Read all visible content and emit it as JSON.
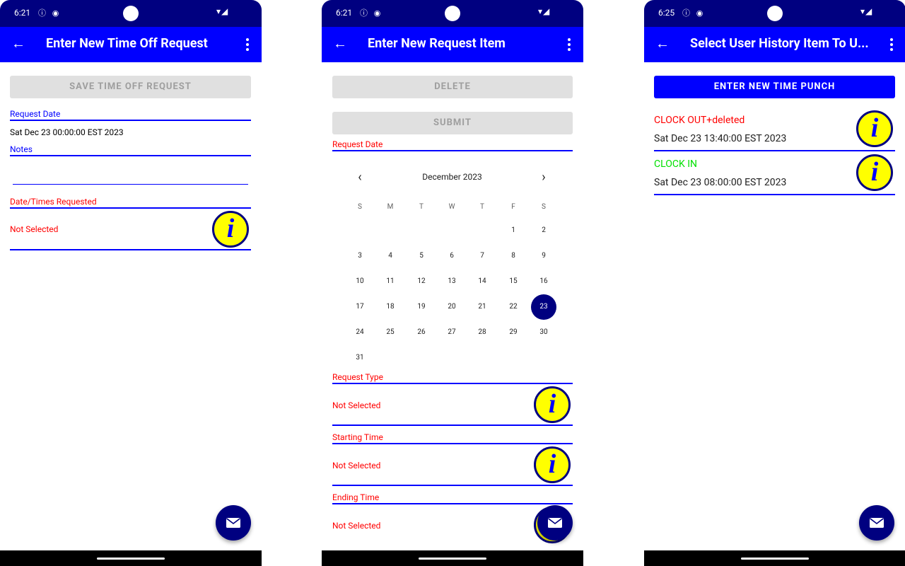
{
  "status_bars": [
    {
      "time": "6:21",
      "left_icons": "ⓘ ◉",
      "right_icons": "▾◢"
    },
    {
      "time": "6:21",
      "left_icons": "ⓘ ◉",
      "right_icons": "▾◢"
    },
    {
      "time": "6:25",
      "left_icons": "ⓘ ◉",
      "right_icons": "▾◢"
    }
  ],
  "screen1": {
    "title": "Enter New Time Off Request",
    "save_label": "SAVE TIME OFF REQUEST",
    "request_date_label": "Request Date",
    "request_date_value": "Sat Dec 23 00:00:00 EST 2023",
    "notes_label": "Notes",
    "notes_value": "",
    "dates_label": "Date/Times Requested",
    "dates_value": "Not Selected"
  },
  "screen2": {
    "title": "Enter New Request Item",
    "delete_label": "DELETE",
    "submit_label": "SUBMIT",
    "request_date_label": "Request Date",
    "calendar": {
      "month": "December 2023",
      "weekdays": [
        "S",
        "M",
        "T",
        "W",
        "T",
        "F",
        "S"
      ],
      "first_weekday": 5,
      "days_in_month": 31,
      "selected_day": 23
    },
    "request_type_label": "Request Type",
    "request_type_value": "Not Selected",
    "start_label": "Starting Time",
    "start_value": "Not Selected",
    "end_label": "Ending Time",
    "end_value": "Not Selected"
  },
  "screen3": {
    "title": "Select User History Item To U...",
    "new_punch_label": "ENTER NEW TIME PUNCH",
    "items": [
      {
        "title": "CLOCK OUT+deleted",
        "time": "Sat Dec 23 13:40:00 EST 2023",
        "color": "#ff0000"
      },
      {
        "title": "CLOCK IN",
        "time": "Sat Dec 23 08:00:00 EST 2023",
        "color": "#00e000"
      }
    ]
  },
  "icons": {
    "back": "arrow-left-icon",
    "menu": "more-vert-icon",
    "info": "i",
    "fab": "mail-icon",
    "prev": "‹",
    "next": "›"
  },
  "colors": {
    "status_bar": "#000080",
    "app_bar": "#0000ff",
    "accent": "#0000ff",
    "error": "#ff0000",
    "info_bg": "#ffff00",
    "fab": "#000080"
  }
}
